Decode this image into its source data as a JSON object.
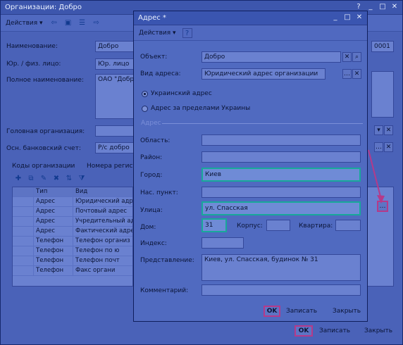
{
  "main_window": {
    "title": "Организации: Добро",
    "menu_actions": "Действия",
    "labels": {
      "name": "Наименование:",
      "legal": "Юр. / физ. лицо:",
      "full_name": "Полное наименование:",
      "parent_org": "Головная организация:",
      "bank_account": "Осн. банковский счет:"
    },
    "values": {
      "name": "Добро",
      "legal": "Юр. лицо",
      "full_name": "ОАО \"Добро\"",
      "bank_account": "Р/с добро",
      "code": "0001"
    },
    "tabs": [
      "Коды организации",
      "Номера регистрации"
    ],
    "grid": {
      "headers": [
        "Тип",
        "Вид"
      ],
      "rows": [
        [
          "Адрес",
          "Юридический адрес"
        ],
        [
          "Адрес",
          "Почтовый адрес"
        ],
        [
          "Адрес",
          "Учредительный адрес"
        ],
        [
          "Адрес",
          "Фактический адрес"
        ],
        [
          "Телефон",
          "Телефон организ"
        ],
        [
          "Телефон",
          "Телефон по ю"
        ],
        [
          "Телефон",
          "Телефон почт"
        ],
        [
          "Телефон",
          "Факс органи"
        ]
      ]
    },
    "buttons": {
      "ok": "OK",
      "save": "Записать",
      "close": "Закрыть"
    }
  },
  "dialog": {
    "title": "Адрес *",
    "menu_actions": "Действия",
    "help": "?",
    "labels": {
      "object": "Объект:",
      "address_type": "Вид адреса:",
      "section": "Адрес",
      "region": "Область:",
      "district": "Район:",
      "city": "Город:",
      "settlement": "Нас. пункт:",
      "street": "Улица:",
      "house": "Дом:",
      "building": "Корпус:",
      "apartment": "Квартира:",
      "index": "Индекс:",
      "presentation": "Представление:",
      "comment": "Комментарий:"
    },
    "values": {
      "object": "Добро",
      "address_type": "Юридический адрес организации",
      "city": "Киев",
      "street": "ул. Спасская",
      "house": "31",
      "presentation": "Киев, ул. Спасская, будинок № 31"
    },
    "radio": {
      "ukraine": "Украинский адрес",
      "abroad": "Адрес за пределами Украины"
    },
    "buttons": {
      "ok": "OK",
      "save": "Записать",
      "close": "Закрыть"
    }
  }
}
